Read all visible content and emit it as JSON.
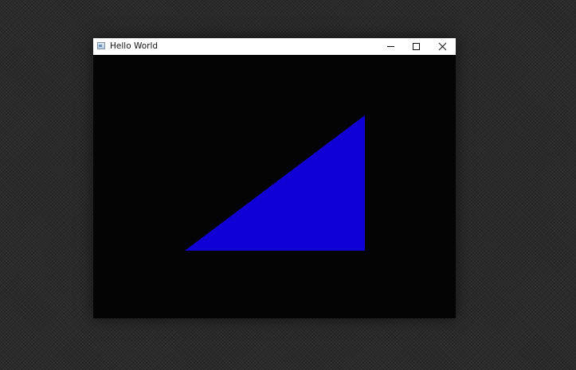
{
  "window": {
    "title": "Hello World"
  },
  "titlebar": {
    "icon": "app-window-icon",
    "controls": [
      "minimize-icon",
      "maximize-icon",
      "close-icon"
    ]
  },
  "canvas": {
    "background_color": "#040404",
    "shape": "triangle",
    "fill_color": "#1000d6"
  }
}
